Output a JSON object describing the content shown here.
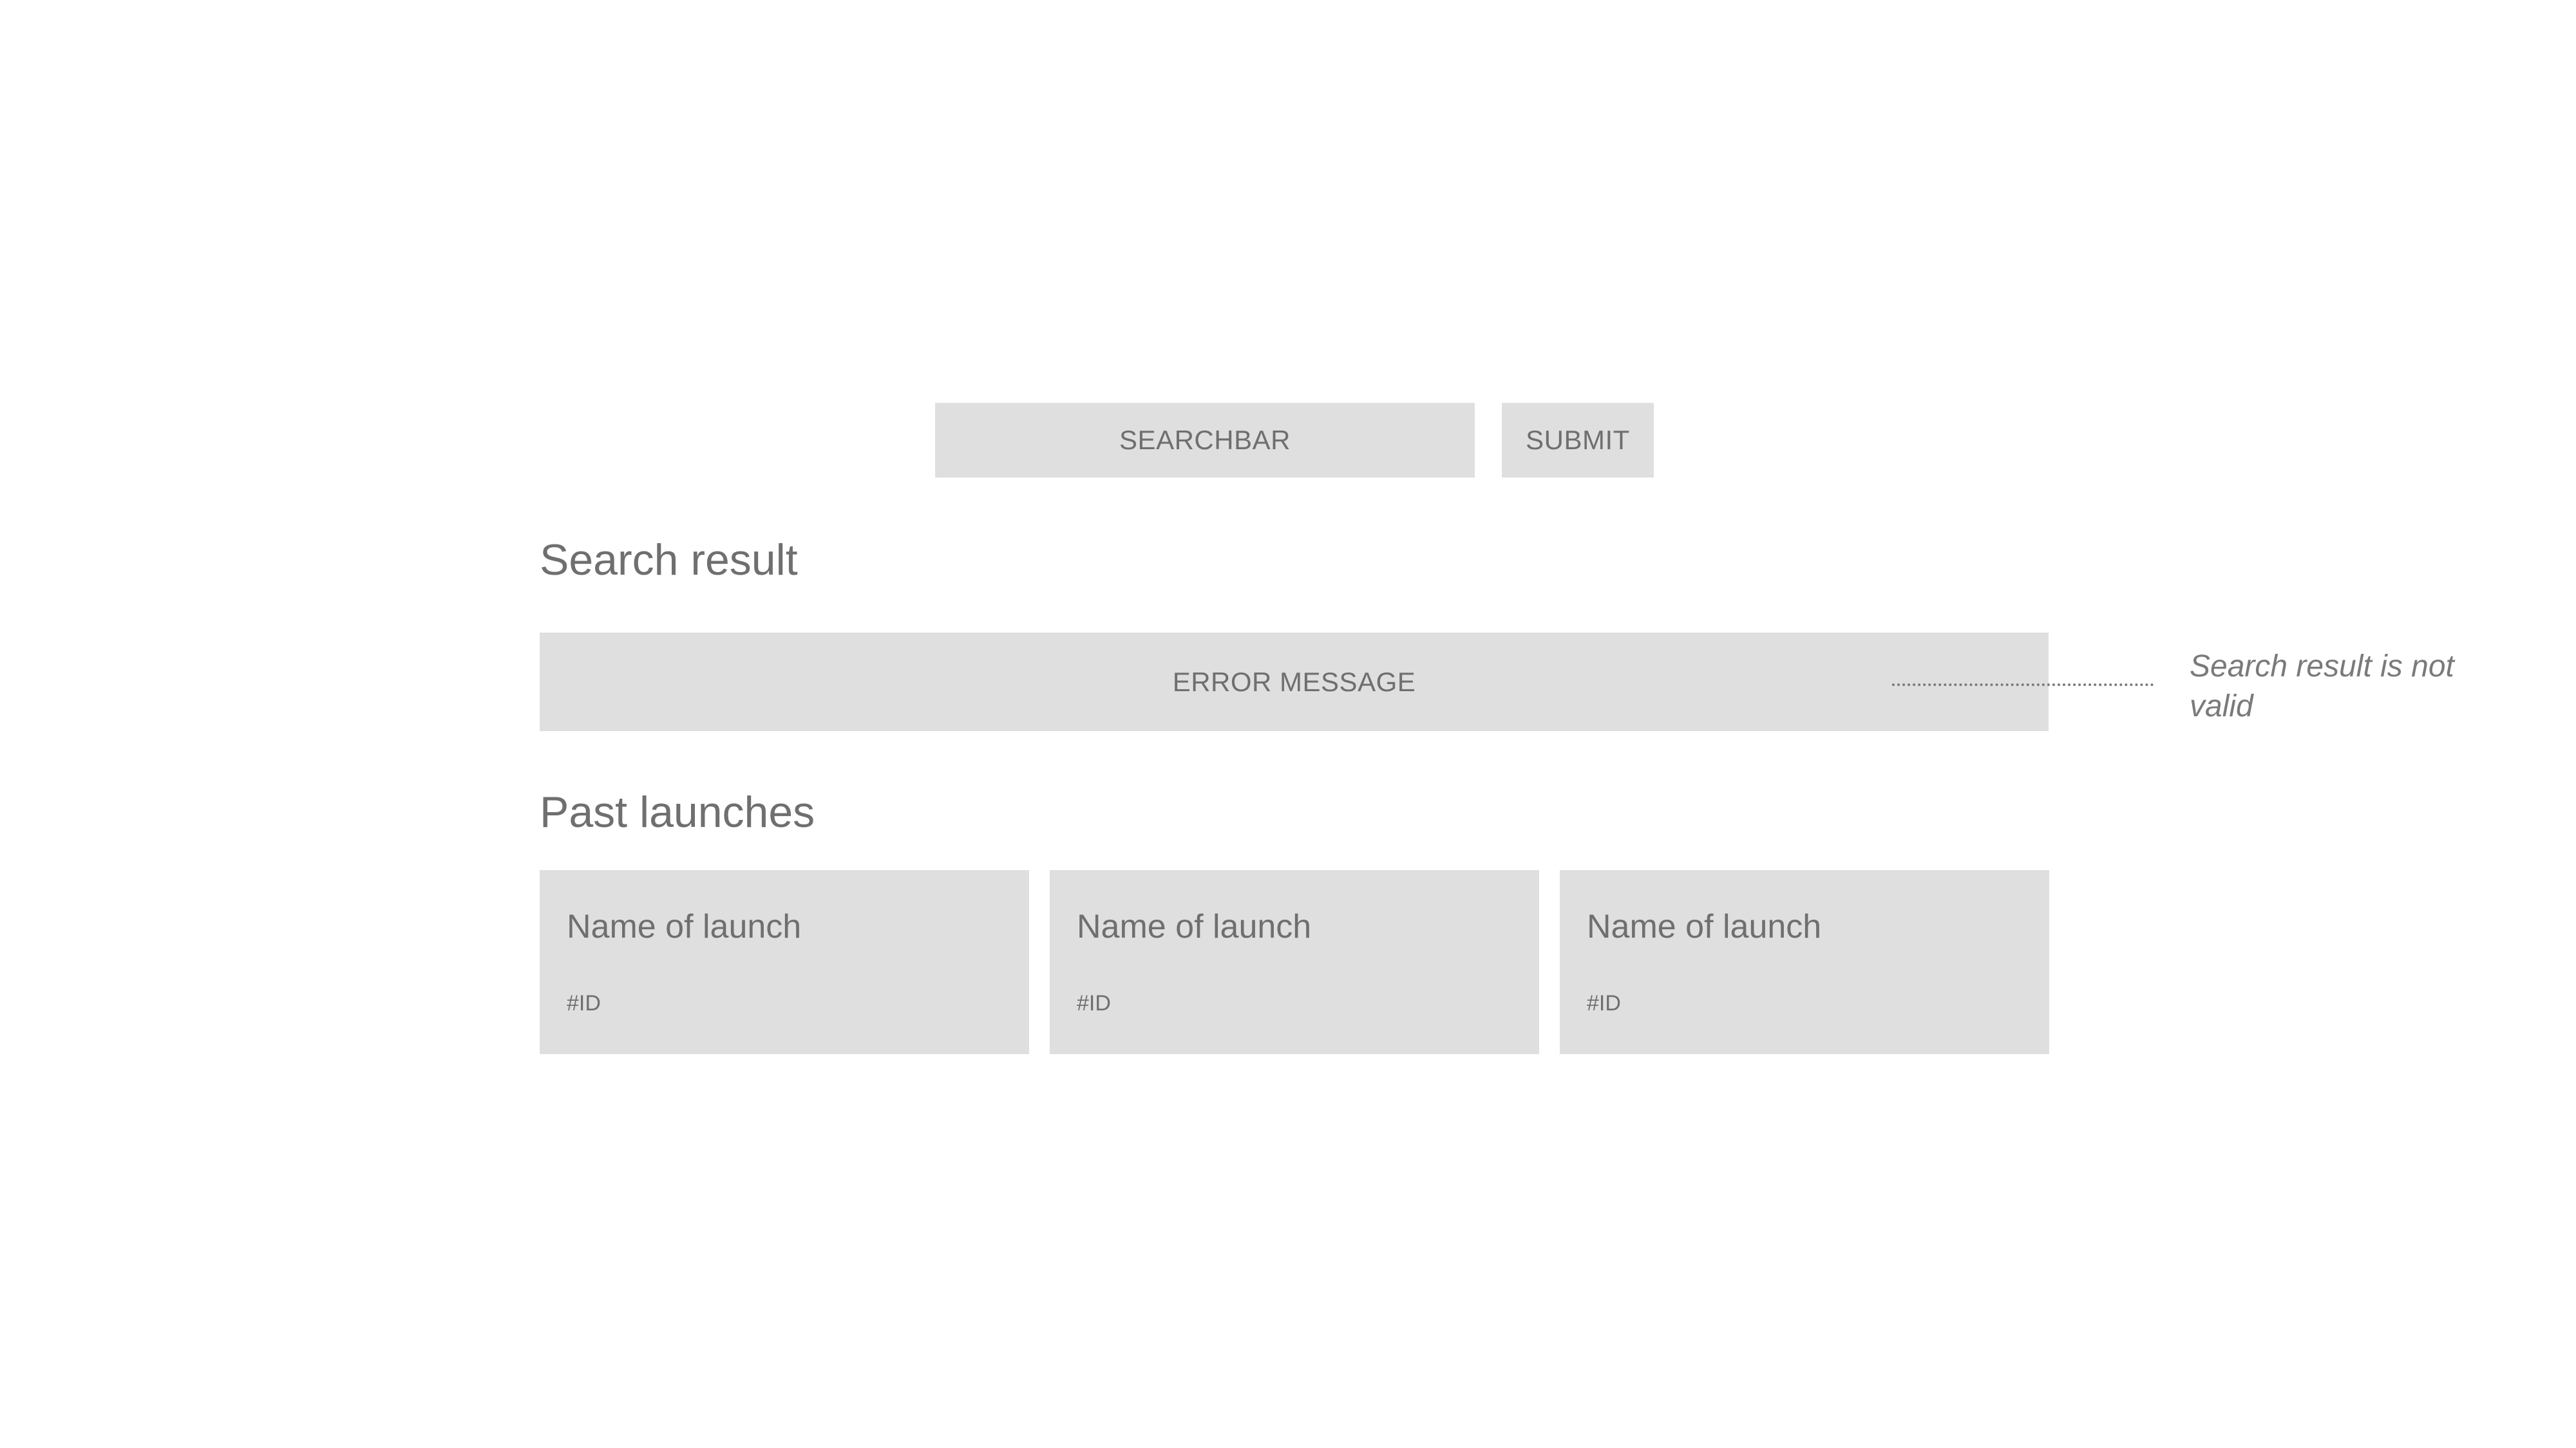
{
  "search": {
    "searchbar_label": "SEARCHBAR",
    "submit_label": "SUBMIT"
  },
  "search_result": {
    "heading": "Search result",
    "error_message": "ERROR MESSAGE",
    "annotation": "Search result is not valid"
  },
  "past_launches": {
    "heading": "Past launches",
    "cards": [
      {
        "name": "Name of launch",
        "id": "#ID"
      },
      {
        "name": "Name of launch",
        "id": "#ID"
      },
      {
        "name": "Name of launch",
        "id": "#ID"
      }
    ]
  },
  "colors": {
    "placeholder_fill": "#dfdfdf",
    "text": "#6f6f6f"
  }
}
